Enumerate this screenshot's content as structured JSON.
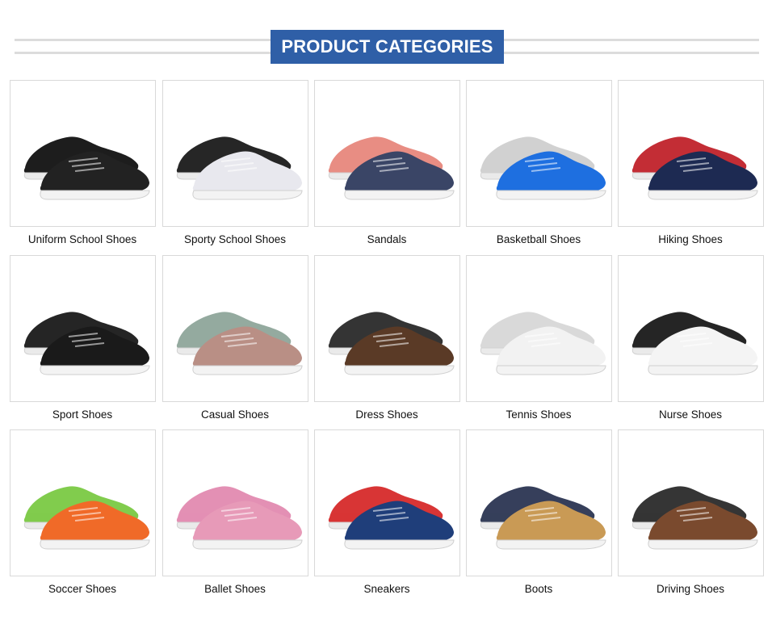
{
  "header": {
    "title": "PRODUCT CATEGORIES"
  },
  "categories": [
    {
      "label": "Uniform School Shoes",
      "icon": "uniform-school-shoe-icon",
      "colors": [
        "#111111",
        "#222222"
      ]
    },
    {
      "label": "Sporty School Shoes",
      "icon": "sporty-school-shoe-icon",
      "colors": [
        "#1b1b1b",
        "#e8e8ee"
      ]
    },
    {
      "label": "Sandals",
      "icon": "sandal-icon",
      "colors": [
        "#e7877d",
        "#3a4566"
      ]
    },
    {
      "label": "Basketball Shoes",
      "icon": "basketball-shoe-icon",
      "colors": [
        "#cfcfcf",
        "#1e6fe0"
      ]
    },
    {
      "label": "Hiking Shoes",
      "icon": "hiking-shoe-icon",
      "colors": [
        "#c0222b",
        "#1d2a52"
      ]
    },
    {
      "label": "Sport Shoes",
      "icon": "sport-shoe-icon",
      "colors": [
        "#1a1a1a",
        "#1a1a1a"
      ]
    },
    {
      "label": "Casual Shoes",
      "icon": "casual-shoe-icon",
      "colors": [
        "#8fa69a",
        "#b98f85"
      ]
    },
    {
      "label": "Dress Shoes",
      "icon": "dress-shoe-icon",
      "colors": [
        "#2a2a2a",
        "#5a3a26"
      ]
    },
    {
      "label": "Tennis Shoes",
      "icon": "tennis-shoe-icon",
      "colors": [
        "#d8d8d8",
        "#f2f2f2"
      ]
    },
    {
      "label": "Nurse Shoes",
      "icon": "nurse-shoe-icon",
      "colors": [
        "#1a1a1a",
        "#f4f4f4"
      ]
    },
    {
      "label": "Soccer Shoes",
      "icon": "soccer-shoe-icon",
      "colors": [
        "#7ac943",
        "#f06a28"
      ]
    },
    {
      "label": "Ballet Shoes",
      "icon": "ballet-shoe-icon",
      "colors": [
        "#e28ab0",
        "#e79ab8"
      ]
    },
    {
      "label": "Sneakers",
      "icon": "sneaker-icon",
      "colors": [
        "#d62a2a",
        "#1f3e7a"
      ]
    },
    {
      "label": "Boots",
      "icon": "boot-icon",
      "colors": [
        "#2b3552",
        "#c99a55"
      ]
    },
    {
      "label": "Driving Shoes",
      "icon": "driving-shoe-icon",
      "colors": [
        "#2a2a2a",
        "#7a4a2e"
      ]
    }
  ]
}
